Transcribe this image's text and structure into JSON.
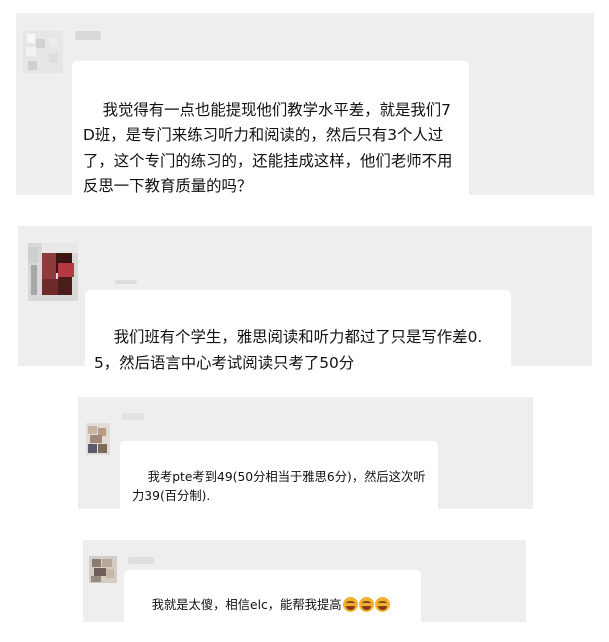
{
  "messages": [
    {
      "text": "我觉得有一点也能提现他们教学水平差，就是我们7D班，是专门来练习听力和阅读的，然后只有3个人过了，这个专门的练习的，还能挂成这样，他们老师不用反思一下教育质量的吗？",
      "avatar_icon": "blurred-avatar-icon",
      "name_hidden": true
    },
    {
      "text": "我们班有个学生，雅思阅读和听力都过了只是写作差0.5，然后语言中心考试阅读只考了50分",
      "avatar_icon": "blurred-avatar-icon",
      "name_hidden": true
    },
    {
      "text": "我考pte考到49(50分相当于雅思6分)，然后这次听力39(百分制).",
      "avatar_icon": "blurred-avatar-icon",
      "name_hidden": true
    },
    {
      "text": "我就是太傻，相信elc，能帮我提高",
      "emoji_icons": [
        "crying-laughing-emoji-icon",
        "crying-laughing-emoji-icon",
        "crying-laughing-emoji-icon"
      ],
      "avatar_icon": "blurred-avatar-icon",
      "name_hidden": true
    }
  ],
  "colors": {
    "page_background": "#ffffff",
    "card_background": "#eeeeee",
    "bubble_background": "#ffffff",
    "text": "#111111"
  }
}
